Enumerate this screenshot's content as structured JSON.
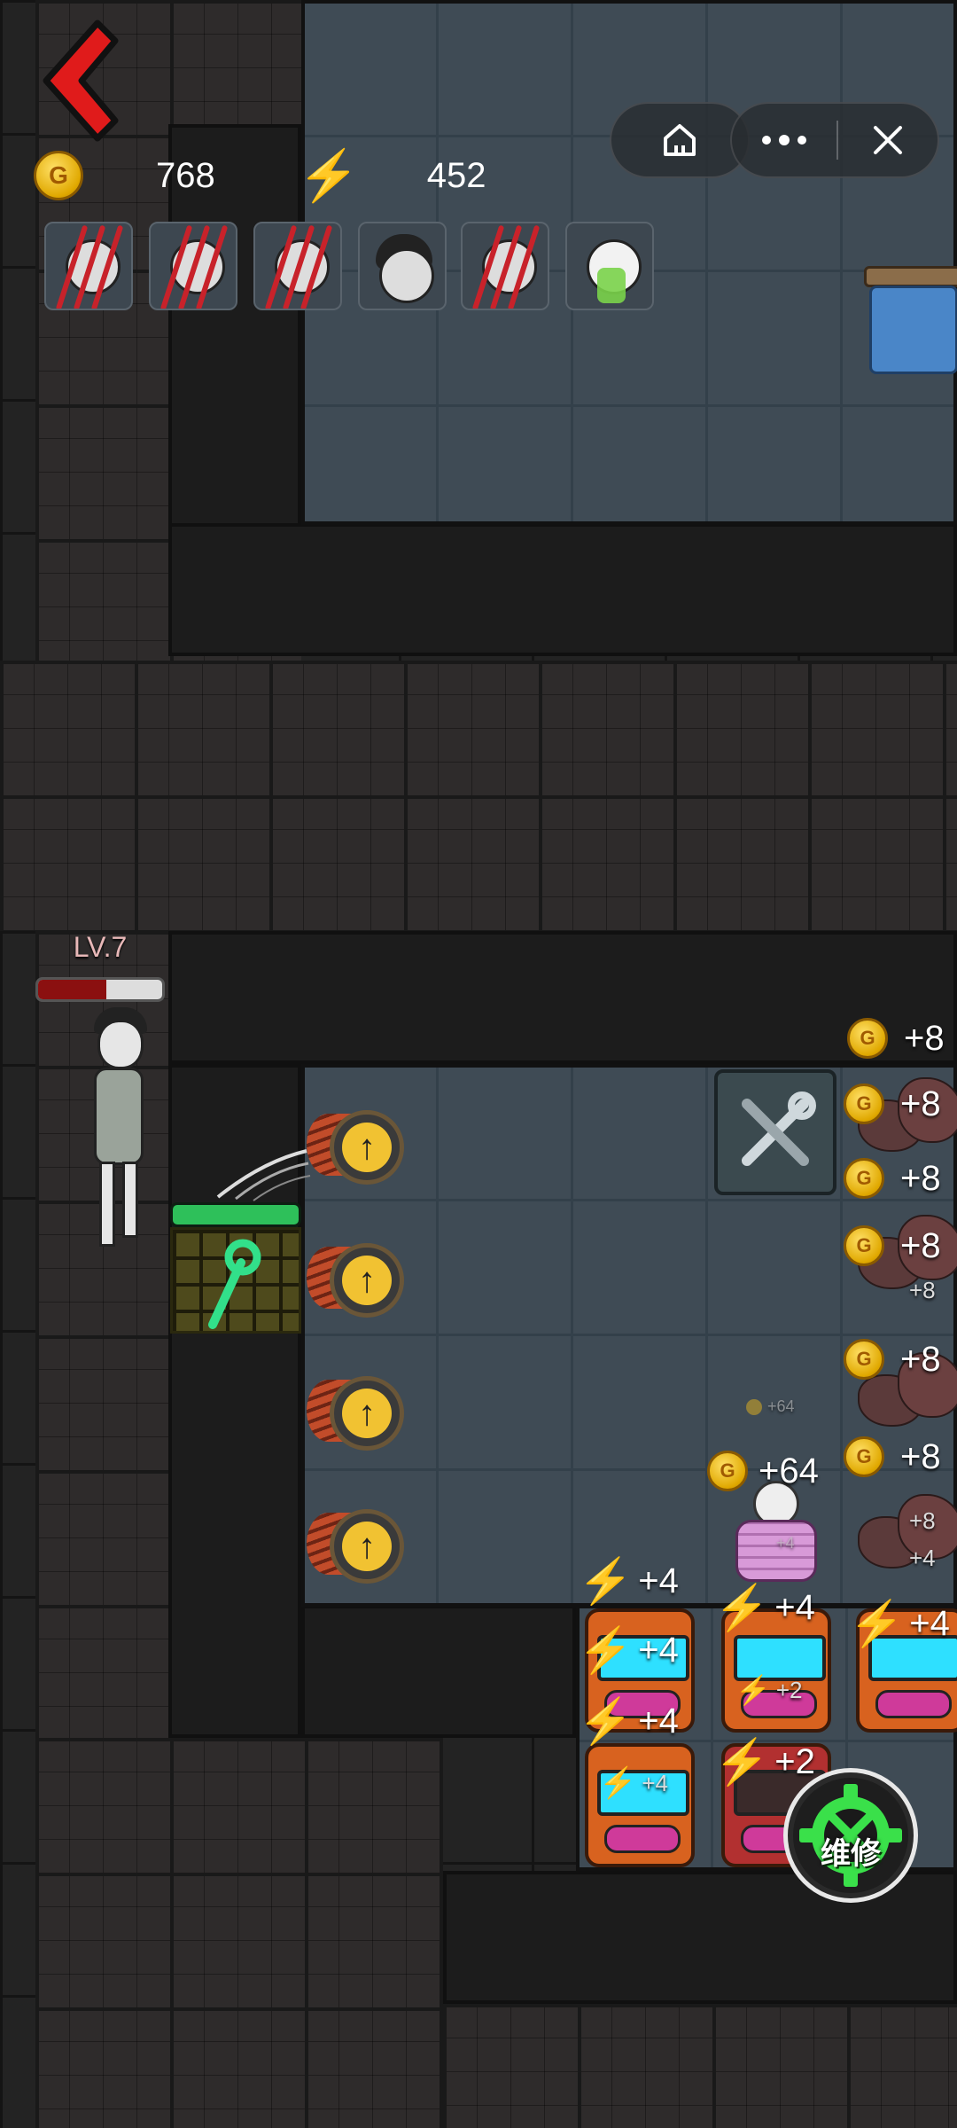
{
  "hud": {
    "gold_value": "768",
    "energy_value": "452",
    "coin_glyph": "G",
    "back_icon": "back-arrow-icon",
    "home_icon": "home-icon",
    "more_icon": "more-icon",
    "close_icon": "close-icon"
  },
  "portraits": [
    {
      "kind": "slashed"
    },
    {
      "kind": "slashed"
    },
    {
      "kind": "slashed"
    },
    {
      "kind": "plain"
    },
    {
      "kind": "slashed"
    },
    {
      "kind": "ghost"
    }
  ],
  "enemy": {
    "level_label": "LV.7",
    "health_fraction": 0.55
  },
  "door": {
    "health_fraction": 1.0
  },
  "gold_gains": {
    "top": "+8",
    "row1": "+8",
    "row2": "+8",
    "row3": "+8",
    "row3_small": "+8",
    "row4": "+8",
    "row5": "+8",
    "row6_small": "+8",
    "bed": "+64",
    "bed_faint": "+64",
    "bed_faint_small": "+4"
  },
  "energy_gains": {
    "a1": "+4",
    "a1_inner": "+4",
    "a2": "+4",
    "a2_inner": "+2",
    "a3": "+4",
    "b1": "+4",
    "b1_inner": "+4",
    "b2": "+2",
    "rock_small": "+4"
  },
  "repair_button": {
    "label": "维修"
  },
  "colors": {
    "enemy_hp": "#8b1010",
    "door_hp": "#2ec05a",
    "repair_green": "#3ae04a",
    "energy_blue": "#5fd0ff",
    "coin_gold": "#f1c232"
  }
}
